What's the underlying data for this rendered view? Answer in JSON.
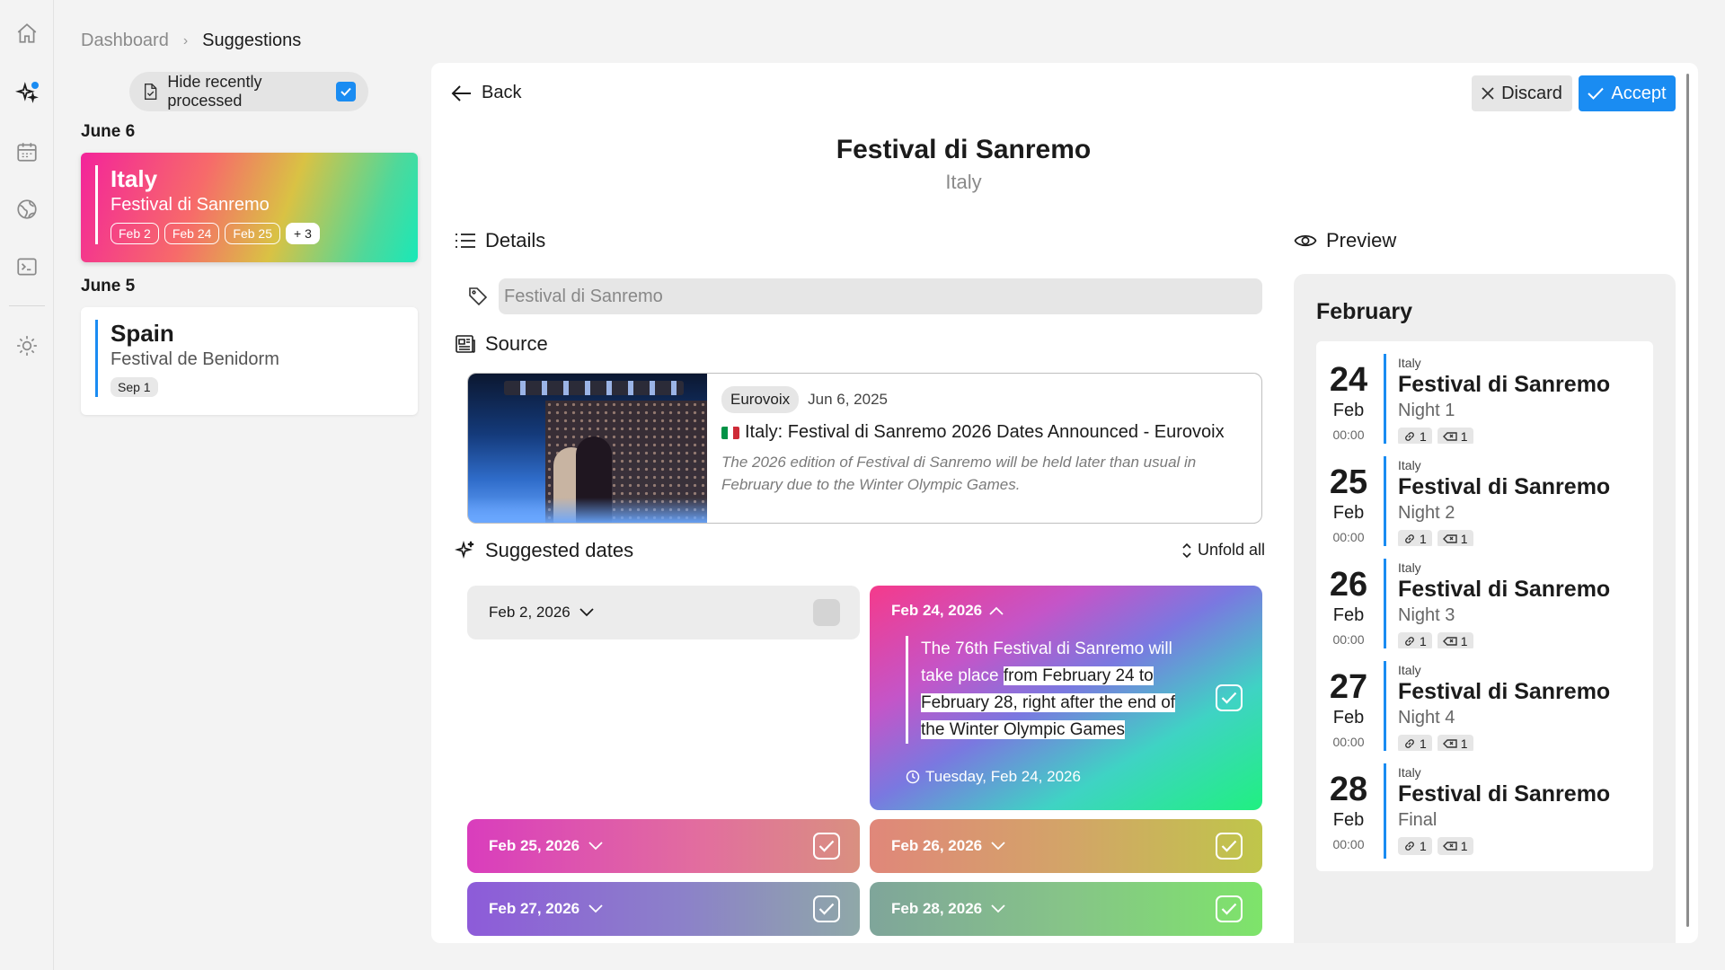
{
  "breadcrumb": {
    "root": "Dashboard",
    "current": "Suggestions"
  },
  "filter": {
    "label": "Hide recently processed",
    "checked": true
  },
  "groups": [
    {
      "date": "June 6",
      "card": {
        "country": "Italy",
        "event": "Festival di Sanremo",
        "chips": [
          "Feb 2",
          "Feb 24",
          "Feb 25"
        ],
        "more": "+ 3"
      }
    },
    {
      "date": "June 5",
      "card": {
        "country": "Spain",
        "event": "Festival de Benidorm",
        "chips": [
          "Sep 1"
        ]
      }
    }
  ],
  "toolbar": {
    "back": "Back",
    "discard": "Discard",
    "accept": "Accept"
  },
  "header": {
    "title": "Festival di Sanremo",
    "subtitle": "Italy"
  },
  "details": {
    "heading": "Details",
    "name_value": "Festival di Sanremo"
  },
  "source": {
    "heading": "Source",
    "publisher": "Eurovoix",
    "date": "Jun 6, 2025",
    "title": "Italy: Festival di Sanremo 2026 Dates Announced - Eurovoix",
    "description": "The 2026 edition of Festival di Sanremo will be held later than usual in February due to the Winter Olympic Games."
  },
  "suggested": {
    "heading": "Suggested dates",
    "unfold": "Unfold all",
    "collapsed_first": "Feb 2, 2026",
    "open": {
      "label": "Feb 24, 2026",
      "quote_plain": "The 76th Festival di Sanremo will take place ",
      "quote_highlight": "from February 24 to February 28, right after the end of the Winter Olympic Games",
      "when": "Tuesday, Feb 24, 2026"
    },
    "rows": [
      "Feb 25, 2026",
      "Feb 26, 2026",
      "Feb 27, 2026",
      "Feb 28, 2026"
    ]
  },
  "preview": {
    "heading": "Preview",
    "month": "February",
    "events": [
      {
        "day": "24",
        "mon": "Feb",
        "time": "00:00",
        "country": "Italy",
        "name": "Festival di Sanremo",
        "sub": "Night 1",
        "links": "1",
        "back": "1"
      },
      {
        "day": "25",
        "mon": "Feb",
        "time": "00:00",
        "country": "Italy",
        "name": "Festival di Sanremo",
        "sub": "Night 2",
        "links": "1",
        "back": "1"
      },
      {
        "day": "26",
        "mon": "Feb",
        "time": "00:00",
        "country": "Italy",
        "name": "Festival di Sanremo",
        "sub": "Night 3",
        "links": "1",
        "back": "1"
      },
      {
        "day": "27",
        "mon": "Feb",
        "time": "00:00",
        "country": "Italy",
        "name": "Festival di Sanremo",
        "sub": "Night 4",
        "links": "1",
        "back": "1"
      },
      {
        "day": "28",
        "mon": "Feb",
        "time": "00:00",
        "country": "Italy",
        "name": "Festival di Sanremo",
        "sub": "Final",
        "links": "1",
        "back": "1"
      }
    ]
  },
  "colors": {
    "accent": "#1a8cf2"
  }
}
